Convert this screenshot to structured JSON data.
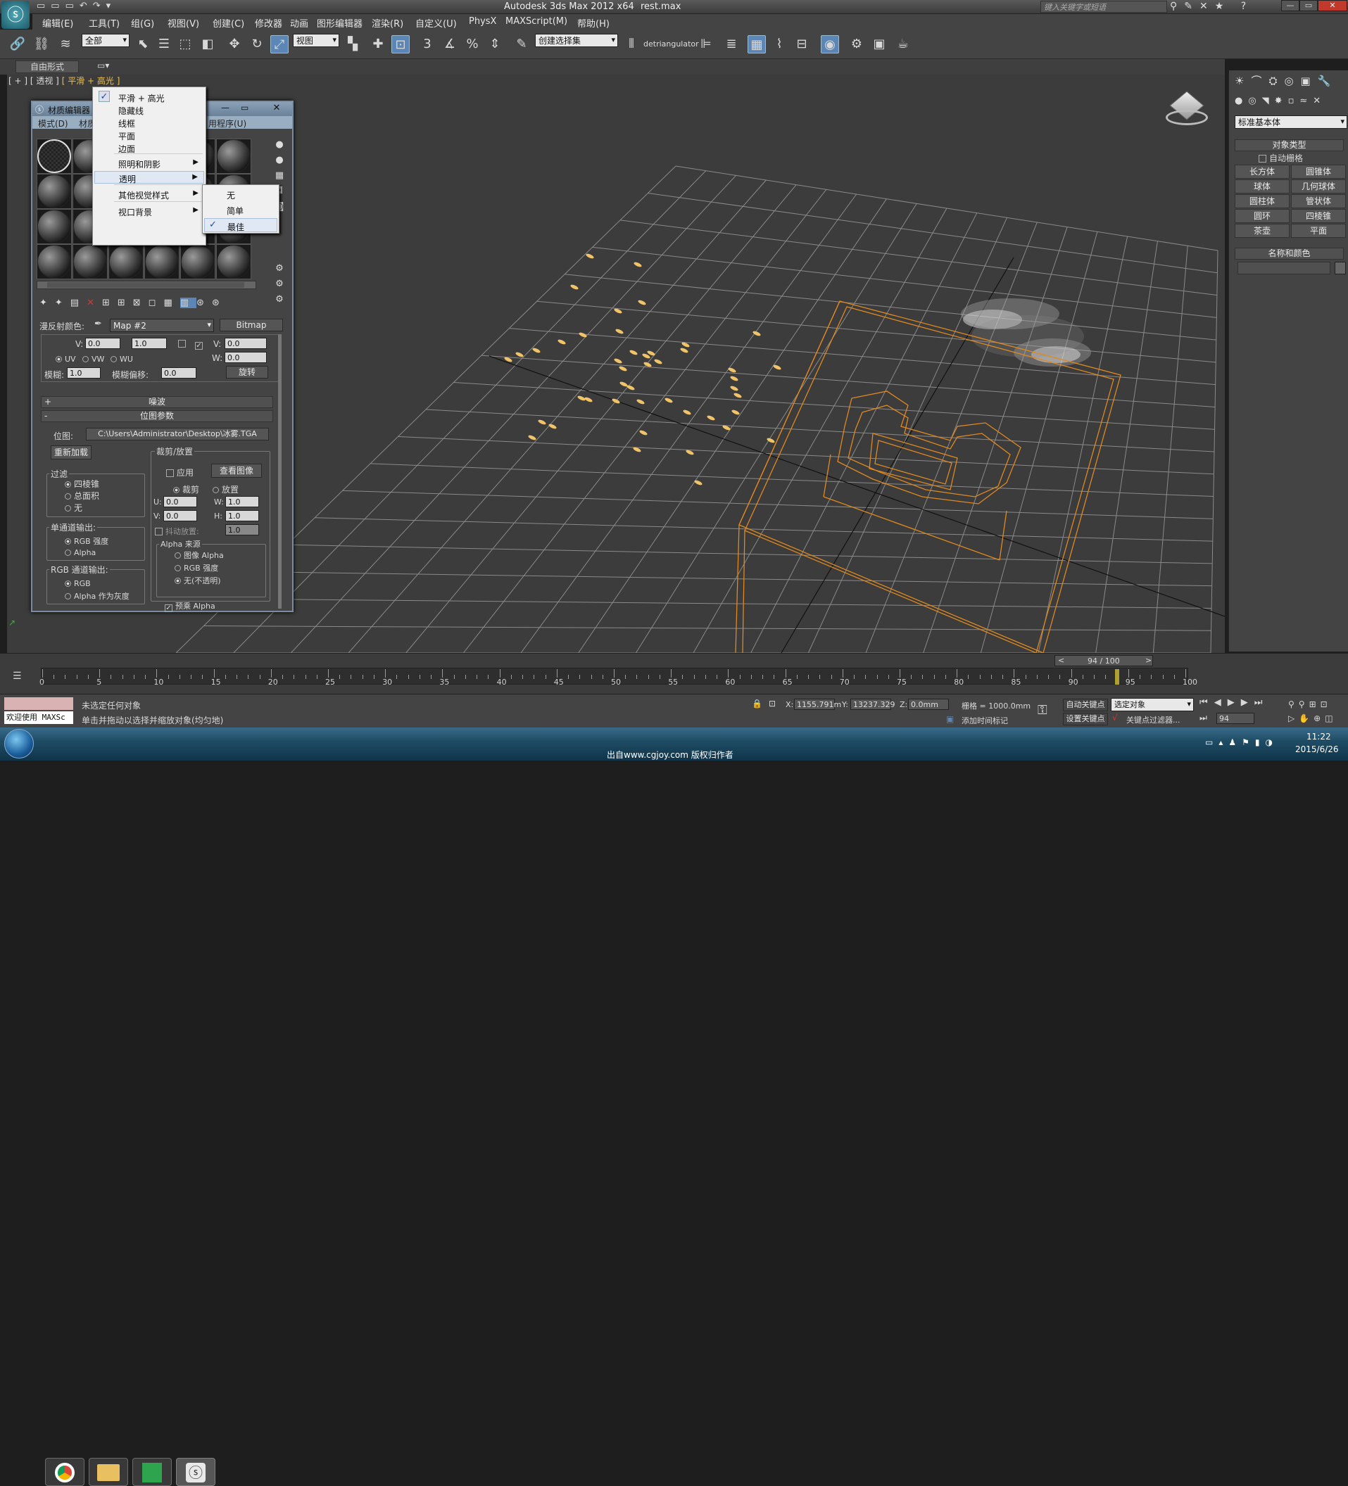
{
  "titlebar": {
    "app_title": "Autodesk 3ds Max  2012 x64",
    "file_name": "rest.max",
    "search_placeholder": "键入关键字或短语"
  },
  "menu": [
    "编辑(E)",
    "工具(T)",
    "组(G)",
    "视图(V)",
    "创建(C)",
    "修改器",
    "动画",
    "图形编辑器",
    "渲染(R)",
    "自定义(U)",
    "PhysX",
    "MAXScript(M)",
    "帮助(H)"
  ],
  "toolbar": {
    "selection_filter": "全部",
    "ref_coord": "视图",
    "named_selection": "创建选择集",
    "plugin_label": "detriangulator"
  },
  "ribbon": {
    "tab": "自由形式"
  },
  "viewport": {
    "label_parts": [
      "[ + ]",
      "[ 透视 ]",
      "[ 平滑 + 高光 ]"
    ]
  },
  "context_menu": {
    "items": [
      {
        "label": "平滑 + 高光",
        "checked": true
      },
      {
        "label": "隐藏线"
      },
      {
        "label": "线框"
      },
      {
        "label": "平面"
      },
      {
        "label": "边面"
      },
      {
        "label": "照明和阴影",
        "submenu": true
      },
      {
        "label": "透明",
        "submenu": true,
        "highlight": true
      },
      {
        "label": "其他视觉样式",
        "submenu": true
      },
      {
        "label": "视口背景",
        "submenu": true
      }
    ],
    "submenu_items": [
      {
        "label": "无"
      },
      {
        "label": "简单"
      },
      {
        "label": "最佳",
        "checked": true
      }
    ]
  },
  "material_editor": {
    "title": "材质编辑器",
    "menu": [
      "模式(D)",
      "材质",
      "用程序(U)"
    ],
    "diffuse_label": "漫反射颜色:",
    "map_name": "Map #2",
    "map_type": "Bitmap",
    "coords": {
      "v_label": "V:",
      "v_value": "0.0",
      "v_tile": "1.0",
      "v2_label": "V:",
      "v2_value": "0.0",
      "w_label": "W:",
      "w_value": "0.0",
      "uv": "UV",
      "vw": "VW",
      "wu": "WU",
      "blur_label": "模糊:",
      "blur_value": "1.0",
      "blur_offset_label": "模糊偏移:",
      "blur_offset_value": "0.0",
      "rotate": "旋转"
    },
    "noise_rollout": "噪波",
    "bitmap_rollout": "位图参数",
    "bitmap_label": "位图:",
    "bitmap_path": "C:\\Users\\Administrator\\Desktop\\冰雾.TGA",
    "reload": "重新加载",
    "crop_group": "裁剪/放置",
    "apply": "应用",
    "view_image": "查看图像",
    "crop": "裁剪",
    "place": "放置",
    "u_label": "U:",
    "u_value": "0.0",
    "w2_label": "W:",
    "w2_value": "1.0",
    "v3_label": "V:",
    "v3_value": "0.0",
    "h_label": "H:",
    "h_value": "1.0",
    "jitter": "抖动放置:",
    "jitter_value": "1.0",
    "filter_group": "过滤",
    "filters": [
      "四棱锥",
      "总面积",
      "无"
    ],
    "mono_group": "单通道输出:",
    "mono_opts": [
      "RGB 强度",
      "Alpha"
    ],
    "rgb_group": "RGB 通道输出:",
    "rgb_opts": [
      "RGB",
      "Alpha 作为灰度"
    ],
    "alpha_group": "Alpha 来源",
    "alpha_opts": [
      "图像 Alpha",
      "RGB 强度",
      "无(不透明)"
    ],
    "premult": "预乘 Alpha"
  },
  "command_panel": {
    "dropdown": "标准基本体",
    "object_type": "对象类型",
    "autogrid": "自动栅格",
    "objects": [
      "长方体",
      "圆锥体",
      "球体",
      "几何球体",
      "圆柱体",
      "管状体",
      "圆环",
      "四棱锥",
      "茶壶",
      "平面"
    ],
    "name_color": "名称和颜色"
  },
  "timeline": {
    "frame_display": "94 / 100",
    "ticks": [
      "0",
      "5",
      "10",
      "15",
      "20",
      "25",
      "30",
      "35",
      "40",
      "45",
      "50",
      "55",
      "60",
      "65",
      "70",
      "75",
      "80",
      "85",
      "90",
      "95",
      "100"
    ]
  },
  "status": {
    "welcome": "欢迎使用 MAXSc",
    "line1": "未选定任何对象",
    "line2": "单击并拖动以选择并缩放对象(均匀地)",
    "x_label": "X:",
    "x_value": "1155.791m",
    "y_label": "Y:",
    "y_value": "13237.329",
    "z_label": "Z:",
    "z_value": "0.0mm",
    "grid": "栅格 = 1000.0mm",
    "add_time_tag": "添加时间标记",
    "auto_key": "自动关键点",
    "auto_key_select": "选定对象",
    "set_key": "设置关键点",
    "key_filters": "关键点过滤器...",
    "frame_value": "94"
  },
  "taskbar": {
    "watermark": "出自www.cgjoy.com 版权归作者",
    "time": "11:22",
    "date": "2015/6/26"
  },
  "colors": {
    "wire": "#e0891e",
    "grid": "#8a8a8a",
    "bg": "#3c3c3c",
    "accent": "#5b86b5"
  }
}
